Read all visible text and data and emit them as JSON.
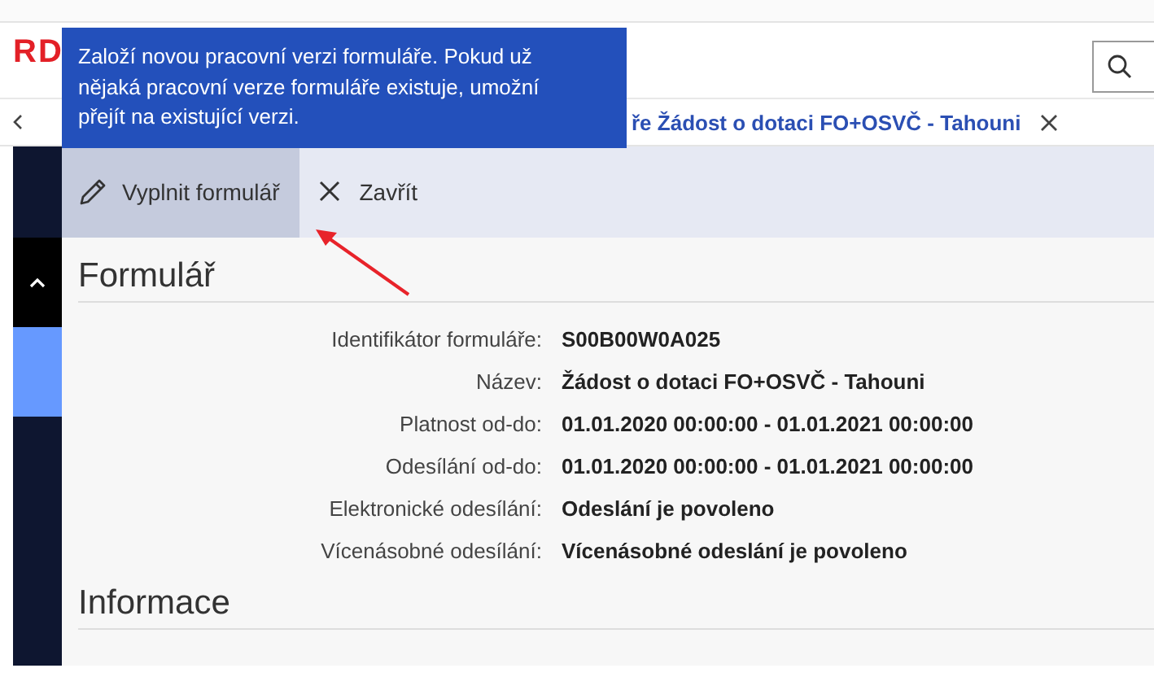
{
  "header": {
    "logo": "RD"
  },
  "breadcrumb": {
    "tab": "ře Žádost o dotaci FO+OSVČ - Tahouni"
  },
  "tooltip": {
    "text": "Založí novou pracovní verzi formuláře. Pokud už nějaká pracovní verze formuláře existuje, umožní přejít na existující verzi."
  },
  "toolbar": {
    "buttons": [
      {
        "label": "Vyplnit formulář",
        "kind": "edit",
        "selected": true
      },
      {
        "label": "Zavřít",
        "kind": "close",
        "selected": false
      }
    ]
  },
  "sidebar": {
    "items": [
      {
        "kind": "toggle",
        "selected": true
      },
      {
        "kind": "item",
        "selected": true
      }
    ]
  },
  "sections": [
    {
      "title": "Formulář",
      "fields": [
        {
          "label": "Identifikátor formuláře:",
          "value": "S00B00W0A025"
        },
        {
          "label": "Název:",
          "value": "Žádost o dotaci FO+OSVČ - Tahouni"
        },
        {
          "label": "Platnost od-do:",
          "value": "01.01.2020 00:00:00 - 01.01.2021 00:00:00"
        },
        {
          "label": "Odesílání od-do:",
          "value": "01.01.2020 00:00:00 - 01.01.2021 00:00:00"
        },
        {
          "label": "Elektronické odesílání:",
          "value": "Odeslání je povoleno"
        },
        {
          "label": "Vícenásobné odesílání:",
          "value": "Vícenásobné odeslání je povoleno"
        }
      ]
    },
    {
      "title": "Informace"
    }
  ]
}
